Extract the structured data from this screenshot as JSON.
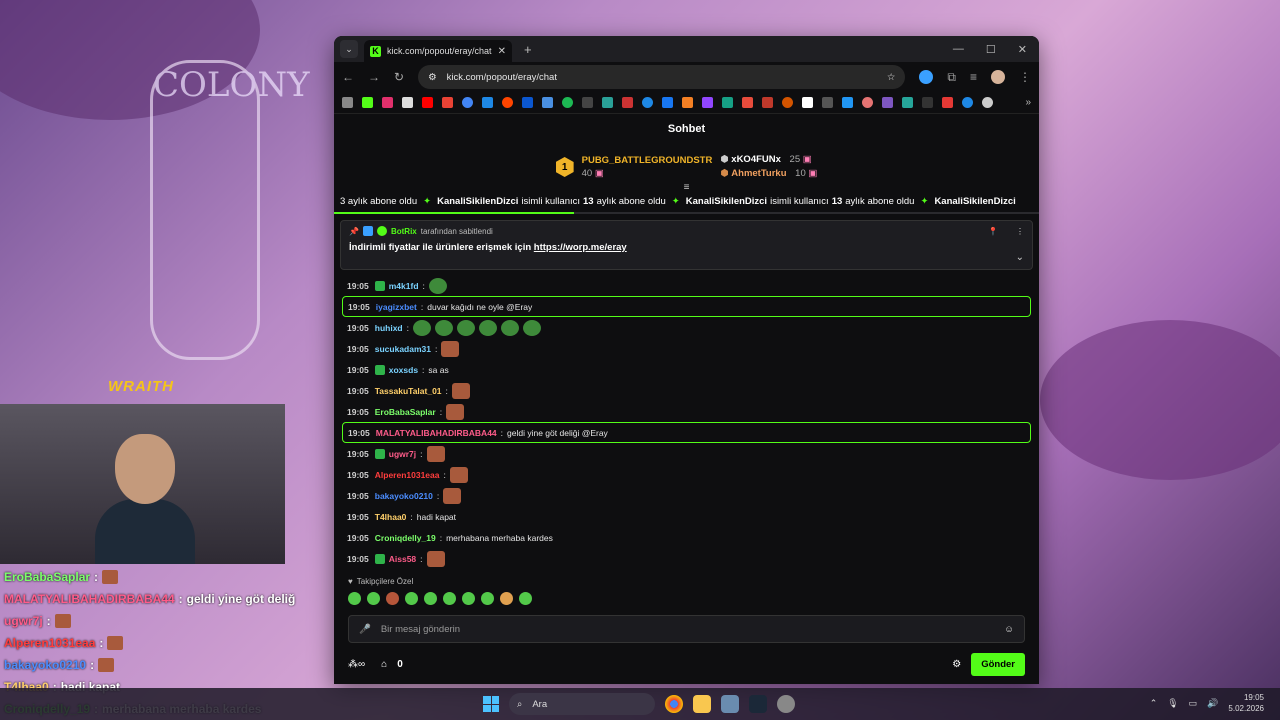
{
  "background": {
    "sign_text": "COLONY",
    "overlay_title": "WRAITH"
  },
  "browser": {
    "tab_title": "kick.com/popout/eray/chat",
    "new_tab": "+",
    "url": "kick.com/popout/eray/chat"
  },
  "chat": {
    "header_title": "Sohbet",
    "leaderboard": {
      "first_rank": "1",
      "first_name": "PUBG_BATTLEGROUNDSTR",
      "first_count": "40",
      "second_name": "xKO4FUNx",
      "second_count": "25",
      "third_name": "AhmetTurku",
      "third_count": "10"
    },
    "ticker": [
      {
        "pre": "3 aylık abone oldu",
        "name": "KanaliSikilenDizci",
        "mid": "isimli kullanıcı",
        "num": "13",
        "post": "aylık abone oldu"
      },
      {
        "name": "KanaliSikilenDizci",
        "mid": "isimli kullanıcı",
        "num": "13",
        "post": "aylık abone oldu"
      },
      {
        "name": "KanaliSikilenDizci"
      }
    ],
    "pinned": {
      "by_user": "BotRix",
      "by_suffix": "tarafından sabitlendi",
      "text": "İndirimli fiyatlar ile ürünlere erişmek için",
      "link": "https://worp.me/eray"
    },
    "messages": [
      {
        "time": "19:05",
        "user": "m4k1fd",
        "color": "#7bd3ff",
        "text": "",
        "emotes": "frog1",
        "badge": true,
        "highlight": false
      },
      {
        "time": "19:05",
        "user": "iyagizxbet",
        "color": "#4b8dff",
        "text": "duvar kağıdı ne oyle @Eray",
        "emotes": "",
        "badge": false,
        "highlight": true
      },
      {
        "time": "19:05",
        "user": "huhixd",
        "color": "#7bd3ff",
        "text": "",
        "emotes": "frog6",
        "badge": false,
        "highlight": false
      },
      {
        "time": "19:05",
        "user": "sucukadam31",
        "color": "#7bd3ff",
        "text": "",
        "emotes": "brown1",
        "badge": false,
        "highlight": false
      },
      {
        "time": "19:05",
        "user": "xoxsds",
        "color": "#7bd3ff",
        "text": "sa as",
        "emotes": "",
        "badge": true,
        "highlight": false
      },
      {
        "time": "19:05",
        "user": "TassakuTalat_01",
        "color": "#ffd06b",
        "text": "",
        "emotes": "brown1",
        "badge": false,
        "highlight": false
      },
      {
        "time": "19:05",
        "user": "EroBabaSaplar",
        "color": "#7cff6b",
        "text": "",
        "emotes": "brown1",
        "badge": false,
        "highlight": false
      },
      {
        "time": "19:05",
        "user": "MALATYALIBAHADIRBABA44",
        "color": "#ff5c8a",
        "text": "geldi yine göt deliği @Eray",
        "emotes": "",
        "badge": false,
        "highlight": true
      },
      {
        "time": "19:05",
        "user": "ugwr7j",
        "color": "#ff5c8a",
        "text": "",
        "emotes": "brown1",
        "badge": true,
        "highlight": false
      },
      {
        "time": "19:05",
        "user": "Alperen1031eaa",
        "color": "#ff3d3d",
        "text": "",
        "emotes": "brown1",
        "badge": false,
        "highlight": false
      },
      {
        "time": "19:05",
        "user": "bakayoko0210",
        "color": "#4b8dff",
        "text": "",
        "emotes": "brown1",
        "badge": false,
        "highlight": false
      },
      {
        "time": "19:05",
        "user": "T4lhaa0",
        "color": "#ffd06b",
        "text": "hadi kapat",
        "emotes": "",
        "badge": false,
        "highlight": false
      },
      {
        "time": "19:05",
        "user": "Croniqdelly_19",
        "color": "#7cff6b",
        "text": "merhabana merhaba kardes",
        "emotes": "",
        "badge": false,
        "highlight": false
      },
      {
        "time": "19:05",
        "user": "Aiss58",
        "color": "#ff5c8a",
        "text": "",
        "emotes": "brown1",
        "badge": true,
        "highlight": false
      }
    ],
    "follower_label": "Takipçilere Özel",
    "input_placeholder": "Bir mesaj gönderin",
    "points_count": "0",
    "send_label": "Gönder"
  },
  "overlay_chat": [
    {
      "user": "EroBabaSaplar",
      "color": "#7cff6b",
      "text": "",
      "emote": true
    },
    {
      "user": "MALATYALIBAHADIRBABA44",
      "color": "#ff5c8a",
      "text": "geldi yine göt deliğ",
      "emote": false
    },
    {
      "user": "ugwr7j",
      "color": "#ff5c8a",
      "text": "",
      "emote": true
    },
    {
      "user": "Alperen1031eaa",
      "color": "#ff3d3d",
      "text": "",
      "emote": true
    },
    {
      "user": "bakayoko0210",
      "color": "#4b8dff",
      "text": "",
      "emote": true
    },
    {
      "user": "T4lhaa0",
      "color": "#ffd06b",
      "text": "hadi kapat",
      "emote": false
    },
    {
      "user": "Croniqdelly_19",
      "color": "#7cff6b",
      "text": "merhabana merhaba kardes",
      "emote": false
    }
  ],
  "taskbar": {
    "search_label": "Ara",
    "time": "19:05",
    "date": "5.02.2026"
  }
}
